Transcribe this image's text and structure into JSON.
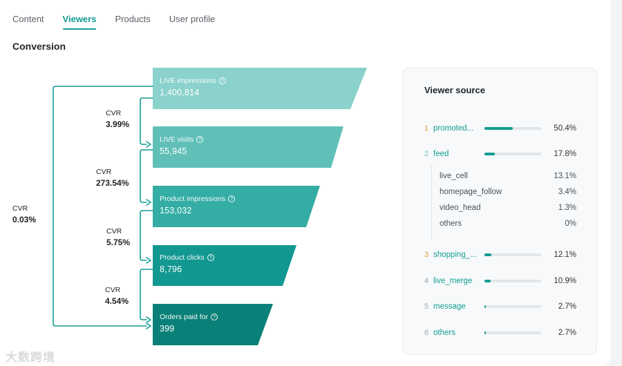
{
  "tabs": [
    "Content",
    "Viewers",
    "Products",
    "User profile"
  ],
  "active_tab": "Viewers",
  "section_title": "Conversion",
  "funnel": [
    {
      "label": "LIVE impressions",
      "value": "1,400,814",
      "color": "#8ad2cb"
    },
    {
      "label": "LIVE visits",
      "value": "55,945",
      "color": "#60c0b8"
    },
    {
      "label": "Product impressions",
      "value": "153,032",
      "color": "#34ada5"
    },
    {
      "label": "Product clicks",
      "value": "8,796",
      "color": "#129891"
    },
    {
      "label": "Orders paid for",
      "value": "399",
      "color": "#0a8178"
    }
  ],
  "step_cvr": [
    {
      "label": "CVR",
      "value": "3.99%"
    },
    {
      "label": "CVR",
      "value": "273.54%"
    },
    {
      "label": "CVR",
      "value": "5.75%"
    },
    {
      "label": "CVR",
      "value": "4.54%"
    }
  ],
  "overall_cvr": {
    "label": "CVR",
    "value": "0.03%"
  },
  "help_icon": "question-circle-icon",
  "viewer_source": {
    "title": "Viewer source",
    "items": [
      {
        "rank": "1",
        "name": "promoted...",
        "pct": "50.4%",
        "fraction": 0.504,
        "rank_color": "#e6a23c"
      },
      {
        "rank": "2",
        "name": "feed",
        "pct": "17.8%",
        "fraction": 0.178,
        "rank_color": "#70c8c0"
      },
      {
        "rank": "3",
        "name": "shopping_...",
        "pct": "12.1%",
        "fraction": 0.121,
        "rank_color": "#e6a23c"
      },
      {
        "rank": "4",
        "name": "live_merge",
        "pct": "10.9%",
        "fraction": 0.109,
        "rank_color": "#a0a4a8"
      },
      {
        "rank": "5",
        "name": "message",
        "pct": "2.7%",
        "fraction": 0.027,
        "rank_color": "#a0a4a8"
      },
      {
        "rank": "6",
        "name": "others",
        "pct": "2.7%",
        "fraction": 0.027,
        "rank_color": "#a0a4a8"
      }
    ],
    "feed_breakdown": [
      {
        "name": "live_cell",
        "pct": "13.1%"
      },
      {
        "name": "homepage_follow",
        "pct": "3.4%"
      },
      {
        "name": "video_head",
        "pct": "1.3%"
      },
      {
        "name": "others",
        "pct": "0%"
      }
    ]
  },
  "watermark": "大数跨境"
}
